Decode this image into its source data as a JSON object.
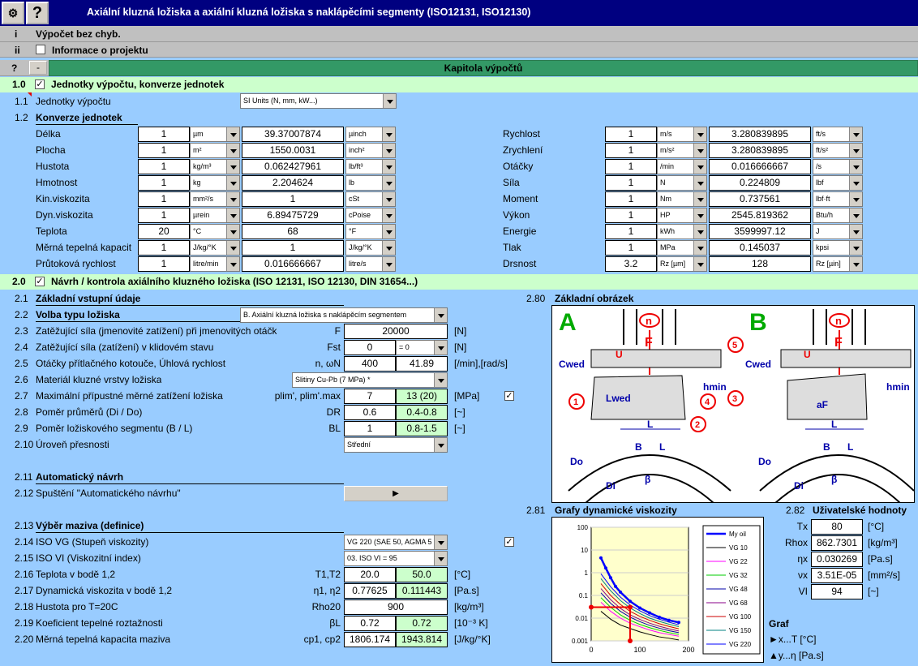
{
  "header": {
    "title": "Axiální kluzná ložiska a axiální kluzná ložiska s naklápěcími segmenty (ISO12131, ISO12130)",
    "help": "?"
  },
  "rows_top": [
    {
      "idx": "i",
      "text": "Výpočet bez chyb."
    },
    {
      "idx": "ii",
      "text": "Informace o projektu"
    }
  ],
  "chapter": {
    "idx": "?",
    "minus": "-",
    "title": "Kapitola výpočtů"
  },
  "sec1": {
    "idx": "1.0",
    "title": "Jednotky výpočtu, konverze jednotek",
    "check": "✓",
    "units_idx": "1.1",
    "units_label": "Jednotky výpočtu",
    "units_value": "SI Units (N, mm, kW...)",
    "conv_idx": "1.2",
    "conv_label": "Konverze jednotek",
    "left": [
      {
        "name": "Délka",
        "val": "1",
        "unit": "µm",
        "res": "39.37007874",
        "unit2": "µinch"
      },
      {
        "name": "Plocha",
        "val": "1",
        "unit": "m²",
        "res": "1550.0031",
        "unit2": "inch²"
      },
      {
        "name": "Hustota",
        "val": "1",
        "unit": "kg/m³",
        "res": "0.062427961",
        "unit2": "lb/ft³"
      },
      {
        "name": "Hmotnost",
        "val": "1",
        "unit": "kg",
        "res": "2.204624",
        "unit2": "lb"
      },
      {
        "name": "Kin.viskozita",
        "val": "1",
        "unit": "mm²/s",
        "res": "1",
        "unit2": "cSt"
      },
      {
        "name": "Dyn.viskozita",
        "val": "1",
        "unit": "µrein",
        "res": "6.89475729",
        "unit2": "cPoise"
      },
      {
        "name": "Teplota",
        "val": "20",
        "unit": "°C",
        "res": "68",
        "unit2": "°F"
      },
      {
        "name": "Měrná tepelná kapacit",
        "val": "1",
        "unit": "J/kg/°K",
        "res": "1",
        "unit2": "J/kg/°K"
      },
      {
        "name": "Průtoková rychlost",
        "val": "1",
        "unit": "litre/min",
        "res": "0.016666667",
        "unit2": "litre/s"
      }
    ],
    "right": [
      {
        "name": "Rychlost",
        "val": "1",
        "unit": "m/s",
        "res": "3.280839895",
        "unit2": "ft/s"
      },
      {
        "name": "Zrychlení",
        "val": "1",
        "unit": "m/s²",
        "res": "3.280839895",
        "unit2": "ft/s²"
      },
      {
        "name": "Otáčky",
        "val": "1",
        "unit": "/min",
        "res": "0.016666667",
        "unit2": "/s"
      },
      {
        "name": "Síla",
        "val": "1",
        "unit": "N",
        "res": "0.224809",
        "unit2": "lbf"
      },
      {
        "name": "Moment",
        "val": "1",
        "unit": "Nm",
        "res": "0.737561",
        "unit2": "lbf·ft"
      },
      {
        "name": "Výkon",
        "val": "1",
        "unit": "HP",
        "res": "2545.819362",
        "unit2": "Btu/h"
      },
      {
        "name": "Energie",
        "val": "1",
        "unit": "kWh",
        "res": "3599997.12",
        "unit2": "J"
      },
      {
        "name": "Tlak",
        "val": "1",
        "unit": "MPa",
        "res": "0.145037",
        "unit2": "kpsi"
      },
      {
        "name": "Drsnost",
        "val": "3.2",
        "unit": "Rz [µm]",
        "res": "128",
        "unit2": "Rz [µin]"
      }
    ]
  },
  "sec2": {
    "idx": "2.0",
    "title": "Návrh / kontrola axiálního kluzného ložiska (ISO 12131, ISO 12130, DIN 31654...)",
    "check": "✓",
    "rows": [
      {
        "idx": "2.1",
        "label": "Základní vstupní údaje",
        "bold": true
      },
      {
        "idx": "2.2",
        "label": "Volba typu ložiska",
        "bold": true,
        "sel": "B. Axiální kluzná ložiska s naklápěcím segmentem"
      },
      {
        "idx": "2.3",
        "label": "Zatěžující síla (jmenovité zatížení) při jmenovitých otáčk",
        "sym": "F",
        "v1": "20000",
        "unit": "[N]"
      },
      {
        "idx": "2.4",
        "label": "Zatěžující síla (zatížení) v klidovém stavu",
        "sym": "Fst",
        "v1": "0",
        "sel2": "= 0",
        "unit": "[N]"
      },
      {
        "idx": "2.5",
        "label": "Otáčky přítlačného kotouče, Úhlová rychlost",
        "sym": "n, ωN",
        "v1": "400",
        "v2": "41.89",
        "unit": "[/min],[rad/s]"
      },
      {
        "idx": "2.6",
        "label": "Materiál kluzné vrstvy ložiska",
        "sel": "Slitiny Cu-Pb  (7 MPa) *"
      },
      {
        "idx": "2.7",
        "label": "Maximální přípustné měrné zatížení ložiska",
        "sym": "plim', plim'.max",
        "v1": "7",
        "v2": "13 (20)",
        "unit": "[MPa]",
        "check": "✓"
      },
      {
        "idx": "2.8",
        "label": "Poměr průměrů (Di / Do)",
        "sym": "DR",
        "v1": "0.6",
        "v2": "0.4-0.8",
        "unit": "[~]"
      },
      {
        "idx": "2.9",
        "label": "Poměr ložiskového segmentu (B / L)",
        "sym": "BL",
        "v1": "1",
        "v2": "0.8-1.5",
        "unit": "[~]"
      },
      {
        "idx": "2.10",
        "label": "Úroveň přesnosti",
        "sel": "Střední"
      },
      {
        "idx": "2.11",
        "label": "Automatický návrh",
        "bold": true
      },
      {
        "idx": "2.12",
        "label": "Spuštění \"Automatického návrhu\"",
        "button": "▶"
      },
      {
        "idx": "2.13",
        "label": "Výběr maziva (definice)",
        "bold": true
      },
      {
        "idx": "2.14",
        "label": "ISO VG (Stupeň viskozity)",
        "sel": "VG 220 (SAE 50, AGMA 5",
        "check": "✓"
      },
      {
        "idx": "2.15",
        "label": "ISO VI (Viskozitní index)",
        "sel": "03. ISO VI = 95"
      },
      {
        "idx": "2.16",
        "label": "Teplota v bodě 1,2",
        "sym": "T1,T2",
        "v1": "20.0",
        "v2": "50.0",
        "unit": "[°C]"
      },
      {
        "idx": "2.17",
        "label": "Dynamická viskozita v bodě 1,2",
        "sym": "η1, η2",
        "v1": "0.77625",
        "v2": "0.111443",
        "unit": "[Pa.s]"
      },
      {
        "idx": "2.18",
        "label": "Hustota pro T=20C",
        "sym": "Rho20",
        "v1": "900",
        "unit": "[kg/m³]"
      },
      {
        "idx": "2.19",
        "label": "Koeficient tepelné roztažnosti",
        "sym": "βL",
        "v1": "0.72",
        "v2": "0.72",
        "unit": "[10⁻³ K]"
      },
      {
        "idx": "2.20",
        "label": "Měrná tepelná kapacita maziva",
        "sym": "cp1, cp2",
        "v1": "1806.174",
        "v2": "1943.814",
        "unit": "[J/kg/°K]"
      }
    ]
  },
  "picture": {
    "idx": "2.80",
    "label": "Základní obrázek",
    "A": "A",
    "B": "B",
    "n": "n",
    "F": "F",
    "U": "U",
    "Cwed": "Cwed",
    "hmin": "hmin",
    "Lwed": "Lwed",
    "aF": "aF",
    "L": "L",
    "Bd": "B",
    "Do": "Do",
    "Di": "Di",
    "beta": "β",
    "c1": "1",
    "c2": "2",
    "c3": "3",
    "c4": "4",
    "c5": "5"
  },
  "graph": {
    "idx": "2.81",
    "label": "Grafy dynamické viskozity",
    "legend": [
      "My oil",
      "VG 10",
      "VG 22",
      "VG 32",
      "VG 48",
      "VG 68",
      "VG 100",
      "VG 150",
      "VG 220"
    ],
    "yticks": [
      "100",
      "10",
      "1",
      "0.1",
      "0.01",
      "0.001"
    ],
    "xticks": [
      "0",
      "100",
      "200"
    ]
  },
  "user": {
    "idx": "2.82",
    "label": "Uživatelské hodnoty",
    "rows": [
      {
        "sym": "Tx",
        "val": "80",
        "unit": "[°C]"
      },
      {
        "sym": "Rhox",
        "val": "862.7301",
        "unit": "[kg/m³]"
      },
      {
        "sym": "ηx",
        "val": "0.030269",
        "unit": "[Pa.s]"
      },
      {
        "sym": "νx",
        "val": "3.51E-05",
        "unit": "[mm²/s]"
      },
      {
        "sym": "VI",
        "val": "94",
        "unit": "[~]"
      }
    ],
    "graf": "Graf",
    "gx": "►x...T [°C]",
    "gy": "▲y...η [Pa.s]"
  },
  "chart_data": {
    "type": "line",
    "xlim": [
      0,
      200
    ],
    "ylim": [
      0.001,
      100
    ],
    "yscale": "log",
    "series": [
      {
        "name": "My oil",
        "x": [
          20,
          30,
          40,
          50,
          60,
          80,
          100,
          120,
          140,
          160,
          180
        ],
        "values": [
          4.5,
          1.6,
          0.6,
          0.25,
          0.14,
          0.055,
          0.028,
          0.017,
          0.011,
          0.008,
          0.0065
        ]
      },
      {
        "name": "VG 10",
        "x": [
          20,
          40,
          60,
          80,
          100,
          120,
          140,
          160,
          180
        ],
        "values": [
          0.02,
          0.009,
          0.005,
          0.0035,
          0.0025,
          0.0019,
          0.0015,
          0.0013,
          0.0011
        ]
      },
      {
        "name": "VG 22",
        "x": [
          20,
          40,
          60,
          80,
          100,
          120,
          140,
          160,
          180
        ],
        "values": [
          0.05,
          0.02,
          0.01,
          0.006,
          0.0042,
          0.003,
          0.0023,
          0.0019,
          0.0016
        ]
      },
      {
        "name": "VG 32",
        "x": [
          20,
          40,
          60,
          80,
          100,
          120,
          140,
          160,
          180
        ],
        "values": [
          0.08,
          0.03,
          0.014,
          0.008,
          0.0053,
          0.0038,
          0.0029,
          0.0023,
          0.0019
        ]
      },
      {
        "name": "VG 48",
        "x": [
          20,
          40,
          60,
          80,
          100,
          120,
          140,
          160,
          180
        ],
        "values": [
          0.13,
          0.045,
          0.02,
          0.011,
          0.007,
          0.0048,
          0.0036,
          0.0028,
          0.0023
        ]
      },
      {
        "name": "VG 68",
        "x": [
          20,
          40,
          60,
          80,
          100,
          120,
          140,
          160,
          180
        ],
        "values": [
          0.2,
          0.065,
          0.027,
          0.014,
          0.0088,
          0.006,
          0.0044,
          0.0034,
          0.0027
        ]
      },
      {
        "name": "VG 100",
        "x": [
          20,
          40,
          60,
          80,
          100,
          120,
          140,
          160,
          180
        ],
        "values": [
          0.33,
          0.1,
          0.04,
          0.02,
          0.012,
          0.008,
          0.0057,
          0.0043,
          0.0034
        ]
      },
      {
        "name": "VG 150",
        "x": [
          20,
          40,
          60,
          80,
          100,
          120,
          140,
          160,
          180
        ],
        "values": [
          0.55,
          0.16,
          0.06,
          0.028,
          0.016,
          0.01,
          0.0072,
          0.0054,
          0.0042
        ]
      },
      {
        "name": "VG 220",
        "x": [
          20,
          40,
          60,
          80,
          100,
          120,
          140,
          160,
          180
        ],
        "values": [
          0.9,
          0.24,
          0.085,
          0.038,
          0.021,
          0.013,
          0.009,
          0.0066,
          0.0051
        ]
      }
    ],
    "marker": {
      "x": 80,
      "y": 0.030269
    },
    "colors": [
      "#0000ff",
      "#000000",
      "#ff00ff",
      "#00cc00",
      "#0000aa",
      "#880088",
      "#cc0000",
      "#008080",
      "#0000ff"
    ]
  }
}
